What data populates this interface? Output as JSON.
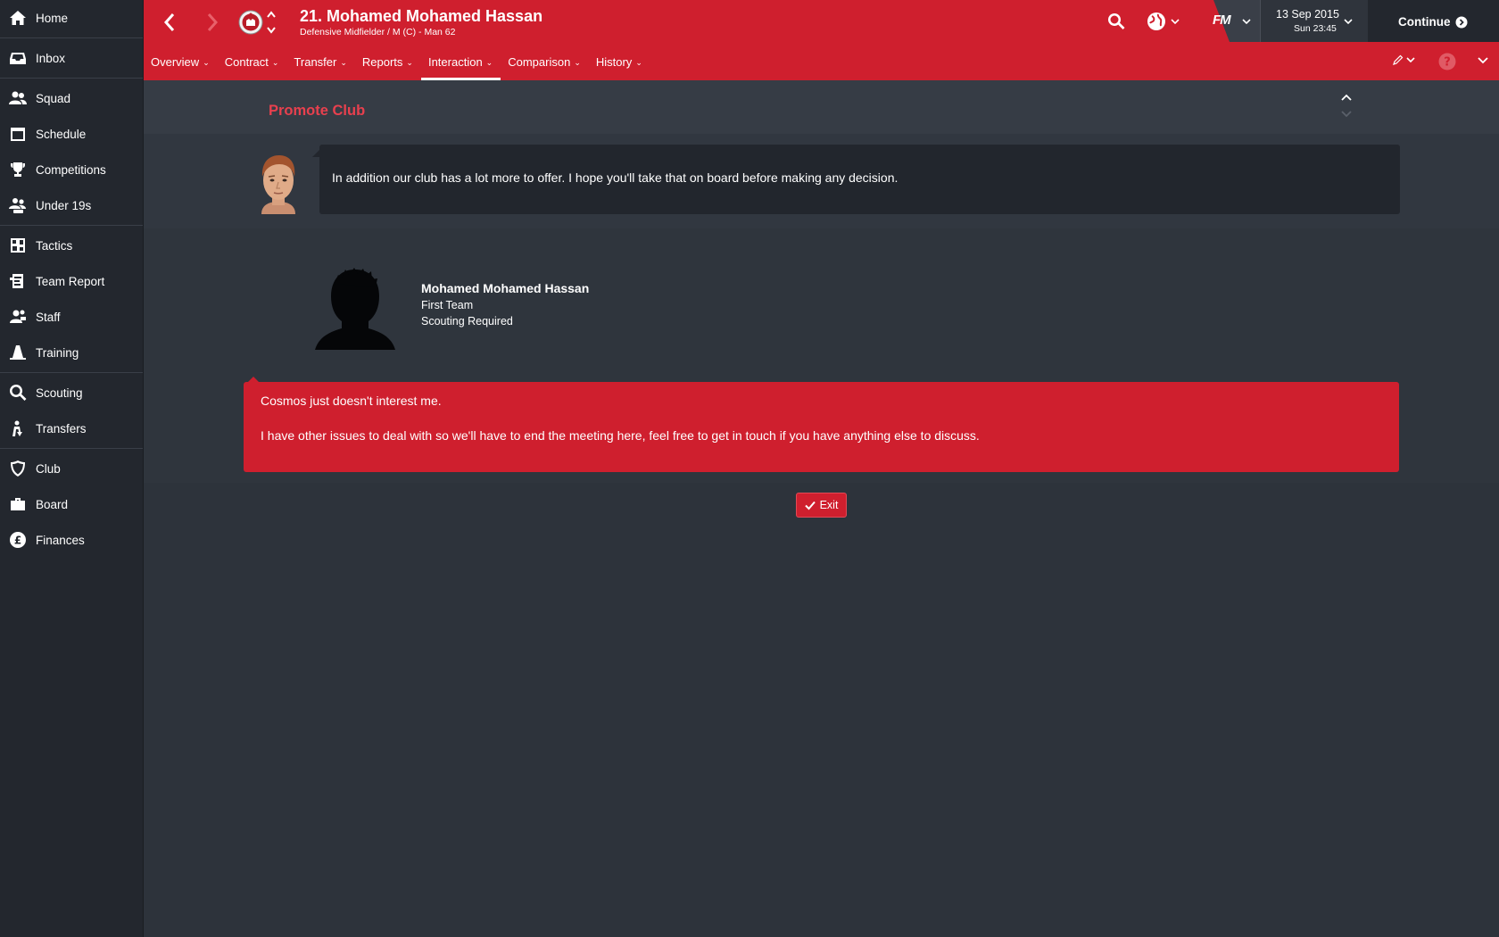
{
  "sidebar": {
    "items": [
      {
        "label": "Home",
        "icon": "home-icon"
      },
      {
        "label": "Inbox",
        "icon": "inbox-icon"
      },
      {
        "label": "Squad",
        "icon": "squad-icon"
      },
      {
        "label": "Schedule",
        "icon": "calendar-icon"
      },
      {
        "label": "Competitions",
        "icon": "trophy-icon"
      },
      {
        "label": "Under 19s",
        "icon": "under19-icon"
      },
      {
        "label": "Tactics",
        "icon": "tactics-icon"
      },
      {
        "label": "Team Report",
        "icon": "report-icon"
      },
      {
        "label": "Staff",
        "icon": "staff-icon"
      },
      {
        "label": "Training",
        "icon": "cone-icon"
      },
      {
        "label": "Scouting",
        "icon": "magnifier-icon"
      },
      {
        "label": "Transfers",
        "icon": "transfer-icon"
      },
      {
        "label": "Club",
        "icon": "shield-icon"
      },
      {
        "label": "Board",
        "icon": "briefcase-icon"
      },
      {
        "label": "Finances",
        "icon": "pound-icon"
      }
    ]
  },
  "header": {
    "title": "21. Mohamed Mohamed Hassan",
    "subtitle": "Defensive Midfielder / M (C) - Man 62",
    "date": "13 Sep 2015",
    "time": "Sun 23:45",
    "fm_logo": "FM",
    "continue_label": "Continue",
    "tabs": [
      {
        "label": "Overview",
        "active": false
      },
      {
        "label": "Contract",
        "active": false
      },
      {
        "label": "Transfer",
        "active": false
      },
      {
        "label": "Reports",
        "active": false
      },
      {
        "label": "Interaction",
        "active": true
      },
      {
        "label": "Comparison",
        "active": false
      },
      {
        "label": "History",
        "active": false
      }
    ],
    "accent_color": "#cf1f2e"
  },
  "section": {
    "title": "Promote Club"
  },
  "manager_message": {
    "text": "In addition our club has a lot more to offer. I hope you'll take that on board before making any decision."
  },
  "contact": {
    "name": "Mohamed Mohamed Hassan",
    "team": "First Team",
    "status": "Scouting Required"
  },
  "reply": {
    "line1": "Cosmos just doesn't interest me.",
    "line2": "I have other issues to deal with so we'll have to end the meeting here, feel free to get in touch if you have anything else to discuss."
  },
  "actions": {
    "exit_label": "Exit"
  }
}
